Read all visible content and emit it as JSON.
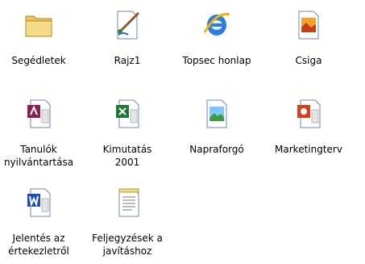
{
  "desktop": {
    "items": [
      {
        "label": "Segédletek",
        "icon": "folder-icon"
      },
      {
        "label": "Rajz1",
        "icon": "paint-bitmap-icon"
      },
      {
        "label": "Topsec honlap",
        "icon": "internet-explorer-icon"
      },
      {
        "label": "Csiga",
        "icon": "image-file-icon"
      },
      {
        "label": "Tanulók\nnyilvántartása",
        "icon": "access-database-icon"
      },
      {
        "label": "Kimutatás\n2001",
        "icon": "excel-spreadsheet-icon"
      },
      {
        "label": "Napraforgó",
        "icon": "picture-file-icon"
      },
      {
        "label": "Marketingterv",
        "icon": "powerpoint-presentation-icon"
      },
      {
        "label": "Jelentés az\nértekezletről",
        "icon": "word-document-icon"
      },
      {
        "label": "Feljegyzések a\njavításhoz",
        "icon": "notepad-text-icon"
      }
    ]
  }
}
